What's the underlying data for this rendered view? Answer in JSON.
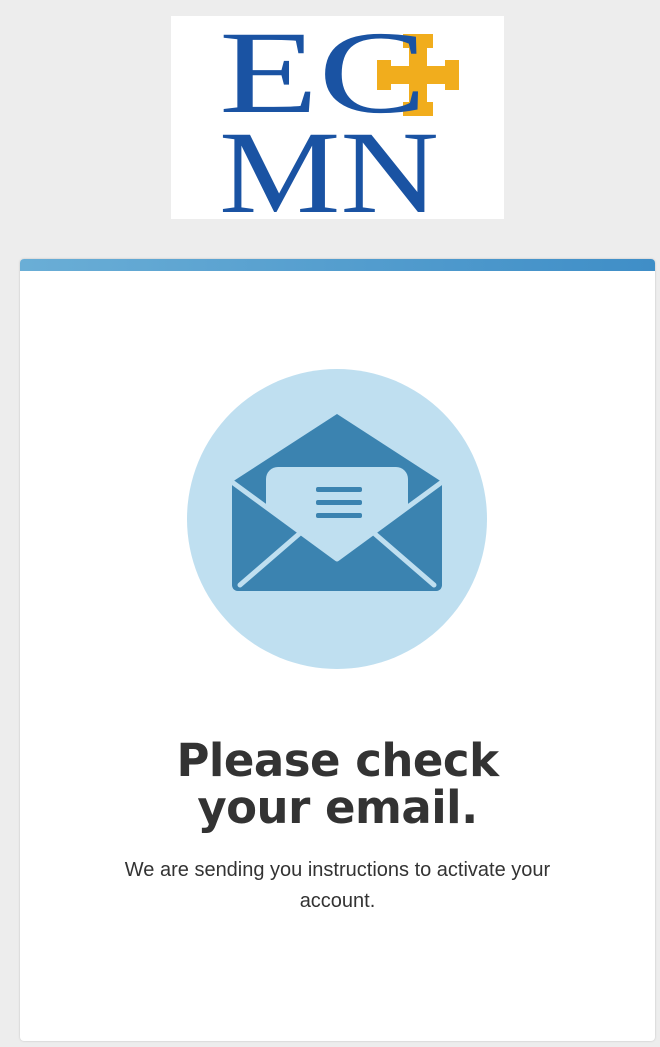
{
  "logo": {
    "line1": "EC",
    "line2": "MN",
    "letter_color": "#1a53a3",
    "cross_color": "#f1ad1d"
  },
  "card": {
    "accent_color": "#4a9bd0",
    "illustration_icon": "open-envelope-icon",
    "illustration_colors": {
      "circle": "#bfdff0",
      "envelope": "#3b83b0"
    },
    "headline_line1": "Please check",
    "headline_line2": "your email.",
    "message": "We are sending you instructions to activate your account."
  }
}
